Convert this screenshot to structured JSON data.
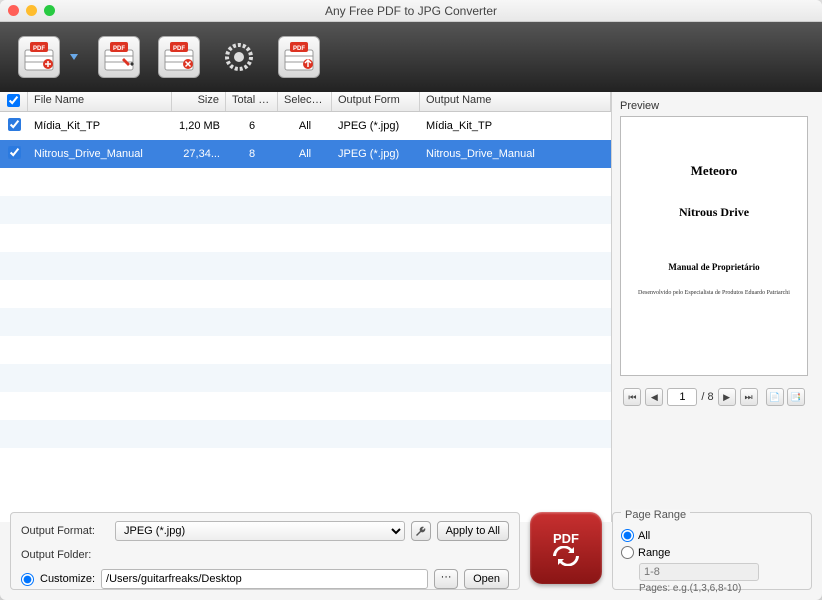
{
  "window": {
    "title": "Any Free PDF to JPG Converter"
  },
  "table": {
    "headers": {
      "filename": "File Name",
      "size": "Size",
      "total": "Total Pa",
      "selected": "Selected",
      "format": "Output Form",
      "outname": "Output Name"
    },
    "rows": [
      {
        "checked": true,
        "name": "Mídia_Kit_TP",
        "size": "1,20 MB",
        "total": "6",
        "selected": "All",
        "format": "JPEG (*.jpg)",
        "outname": "Mídia_Kit_TP",
        "active": false
      },
      {
        "checked": true,
        "name": "Nitrous_Drive_Manual",
        "size": "27,34...",
        "total": "8",
        "selected": "All",
        "format": "JPEG (*.jpg)",
        "outname": "Nitrous_Drive_Manual",
        "active": true
      }
    ]
  },
  "preview": {
    "label": "Preview",
    "line1": "Meteoro",
    "line2": "Nitrous Drive",
    "line3": "Manual de Proprietário",
    "line4": "Desenvolvido pelo Especialista de Produtos Eduardo Patriarchi",
    "page_current": "1",
    "page_total": "/ 8"
  },
  "output": {
    "format_label": "Output Format:",
    "format_value": "JPEG (*.jpg)",
    "apply_label": "Apply to All",
    "folder_label": "Output Folder:",
    "customize_label": "Customize:",
    "path": "/Users/guitarfreaks/Desktop",
    "open_label": "Open"
  },
  "convert": {
    "pdf": "PDF"
  },
  "page_range": {
    "title": "Page Range",
    "all": "All",
    "range": "Range",
    "placeholder": "1-8",
    "hint": "Pages: e.g.(1,3,6,8-10)"
  }
}
